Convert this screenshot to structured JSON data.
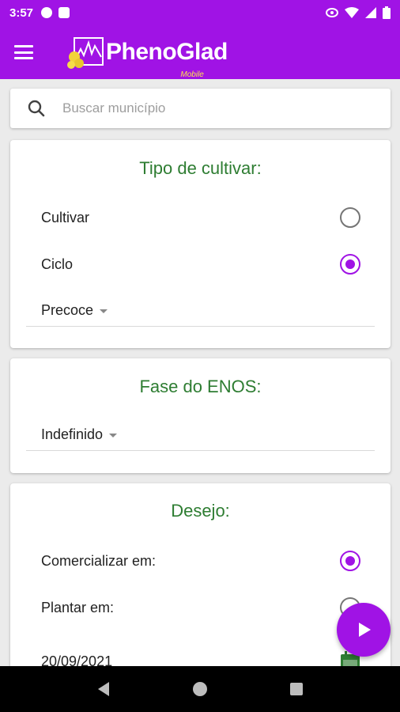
{
  "status_bar": {
    "time": "3:57"
  },
  "app_bar": {
    "logo_title": "PhenoGlad",
    "logo_subtitle": "Mobile"
  },
  "search": {
    "placeholder": "Buscar município",
    "value": ""
  },
  "tipo_cultivar": {
    "title": "Tipo de cultivar:",
    "options": [
      {
        "label": "Cultivar",
        "selected": false
      },
      {
        "label": "Ciclo",
        "selected": true
      }
    ],
    "dropdown_value": "Precoce"
  },
  "enos": {
    "title": "Fase do ENOS:",
    "dropdown_value": "Indefinido"
  },
  "desejo": {
    "title": "Desejo:",
    "options": [
      {
        "label": "Comercializar em:",
        "selected": true
      },
      {
        "label": "Plantar em:",
        "selected": false
      }
    ],
    "date": "20/09/2021"
  },
  "colors": {
    "primary": "#a013e5",
    "title_green": "#2e7d32",
    "calendar_green": "#2e7d32"
  }
}
